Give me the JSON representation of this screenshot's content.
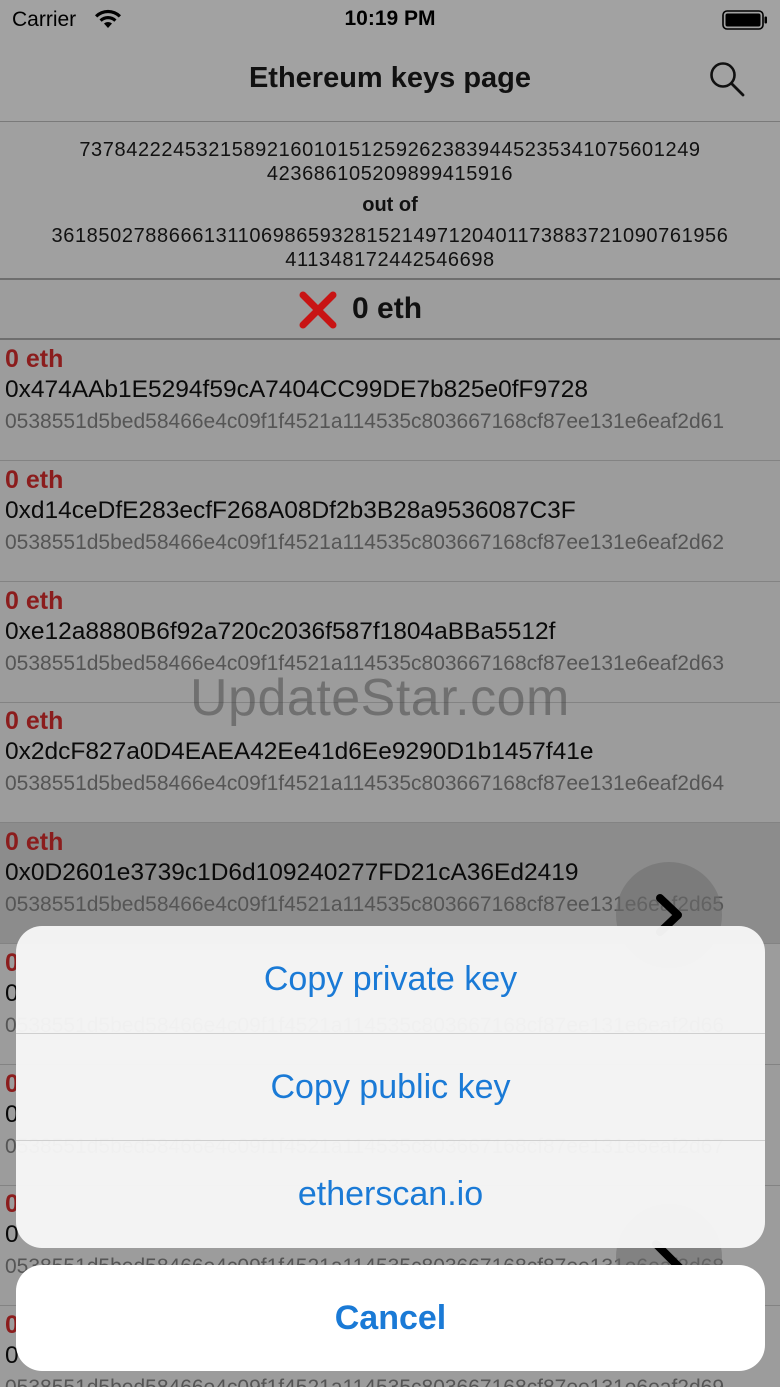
{
  "status_bar": {
    "carrier": "Carrier",
    "time": "10:19 PM"
  },
  "navbar": {
    "title": "Ethereum keys page",
    "icon": "search-icon"
  },
  "range": {
    "from_line1": "7378422245321589216010151259262383944523534107560124 9",
    "from_line1_exact": "73784222453215892160101512592623839445235341075601249",
    "from_line2": "42368610520989941591 6",
    "from_line2_exact": "423686105209899415916",
    "out_of": "out of",
    "to_line1": "36185027886661311069865932815214971204011738837210907619 56",
    "to_line1_exact": "3618502788666131106986593281521497120401173883721090761956",
    "to_line2": "411348172442546698"
  },
  "total": {
    "icon": "red-cross-icon",
    "value": "0 eth"
  },
  "rows": [
    {
      "balance": "0 eth",
      "address": "0x474AAb1E5294f59cA7404CC99DE7b825e0fF9728",
      "private_key": "0538551d5bed58466e4c09f1f4521a114535c803667168cf87ee131e6eaf2d61"
    },
    {
      "balance": "0 eth",
      "address": "0xd14ceDfE283ecfF268A08Df2b3B28a9536087C3F",
      "private_key": "0538551d5bed58466e4c09f1f4521a114535c803667168cf87ee131e6eaf2d62"
    },
    {
      "balance": "0 eth",
      "address": "0xe12a8880B6f92a720c2036f587f1804aBBa5512f",
      "private_key": "0538551d5bed58466e4c09f1f4521a114535c803667168cf87ee131e6eaf2d63"
    },
    {
      "balance": "0 eth",
      "address": "0x2dcF827a0D4EAEA42Ee41d6Ee9290D1b1457f41e",
      "private_key": "0538551d5bed58466e4c09f1f4521a114535c803667168cf87ee131e6eaf2d64"
    },
    {
      "balance": "0 eth",
      "address": "0x0D2601e3739c1D6d109240277FD21cA36Ed2419",
      "private_key": "0538551d5bed58466e4c09f1f4521a114535c803667168cf87ee131e6eaf2d65"
    },
    {
      "balance": "0",
      "address": "0",
      "private_key": "0538551d5bed58466e4c09f1f4521a114535c803667168cf87ee131e6eaf2d66"
    },
    {
      "balance": "0",
      "address": "0",
      "private_key": "0538551d5bed58466e4c09f1f4521a114535c803667168cf87ee131e6eaf2d67"
    },
    {
      "balance": "0",
      "address": "0",
      "private_key": "0538551d5bed58466e4c09f1f4521a114535c803667168cf87ee131e6eaf2d68"
    },
    {
      "balance": "0",
      "address": "0",
      "private_key": "0538551d5bed58466e4c09f1f4521a114535c803667168cf87ee131e6eaf2d69"
    }
  ],
  "watermark": "UpdateStar.com",
  "action_sheet": {
    "copy_private": "Copy private key",
    "copy_public": "Copy public key",
    "etherscan": "etherscan.io",
    "cancel": "Cancel"
  },
  "colors": {
    "accent": "#1a7ad6",
    "balance": "#8b1d1d",
    "cross": "#c81414"
  }
}
